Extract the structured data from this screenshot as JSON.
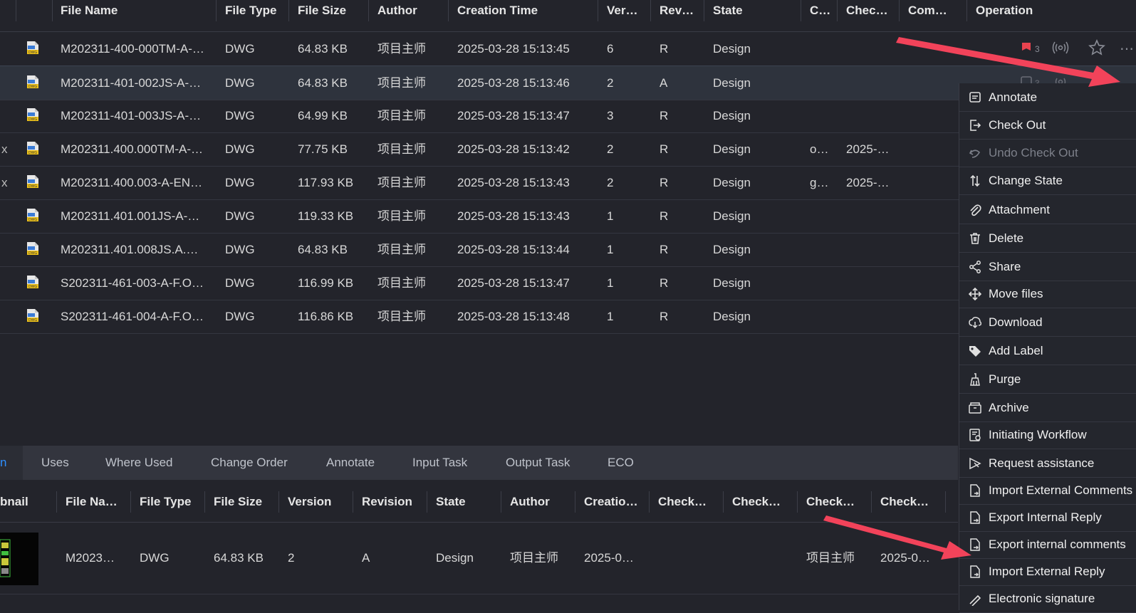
{
  "columns": {
    "file_name": "File Name",
    "file_type": "File Type",
    "file_size": "File Size",
    "author": "Author",
    "creation_time": "Creation Time",
    "version": "Ver…",
    "revision": "Rev…",
    "state": "State",
    "c": "C…",
    "check": "Chec…",
    "com": "Com…",
    "operation": "Operation"
  },
  "rows": [
    {
      "name": "M202311-400-000TM-A-…",
      "type": "DWG",
      "size": "64.83 KB",
      "author": "项目主师",
      "time": "2025-03-28 15:13:45",
      "ver": "6",
      "rev": "R",
      "state": "Design",
      "c": "",
      "check": ""
    },
    {
      "name": "M202311-401-002JS-A-…",
      "type": "DWG",
      "size": "64.83 KB",
      "author": "项目主师",
      "time": "2025-03-28 15:13:46",
      "ver": "2",
      "rev": "A",
      "state": "Design",
      "c": "",
      "check": ""
    },
    {
      "name": "M202311-401-003JS-A-…",
      "type": "DWG",
      "size": "64.99 KB",
      "author": "项目主师",
      "time": "2025-03-28 15:13:47",
      "ver": "3",
      "rev": "R",
      "state": "Design",
      "c": "",
      "check": ""
    },
    {
      "name": "M202311.400.000TM-A-…",
      "type": "DWG",
      "size": "77.75 KB",
      "author": "项目主师",
      "time": "2025-03-28 15:13:42",
      "ver": "2",
      "rev": "R",
      "state": "Design",
      "c": "o…",
      "check": "2025-…"
    },
    {
      "name": "M202311.400.003-A-EN…",
      "type": "DWG",
      "size": "117.93 KB",
      "author": "项目主师",
      "time": "2025-03-28 15:13:43",
      "ver": "2",
      "rev": "R",
      "state": "Design",
      "c": "g…",
      "check": "2025-…"
    },
    {
      "name": "M202311.401.001JS-A-…",
      "type": "DWG",
      "size": "119.33 KB",
      "author": "项目主师",
      "time": "2025-03-28 15:13:43",
      "ver": "1",
      "rev": "R",
      "state": "Design",
      "c": "",
      "check": ""
    },
    {
      "name": "M202311.401.008JS.A.…",
      "type": "DWG",
      "size": "64.83 KB",
      "author": "项目主师",
      "time": "2025-03-28 15:13:44",
      "ver": "1",
      "rev": "R",
      "state": "Design",
      "c": "",
      "check": ""
    },
    {
      "name": "S202311-461-003-A-F.O…",
      "type": "DWG",
      "size": "116.99 KB",
      "author": "项目主师",
      "time": "2025-03-28 15:13:47",
      "ver": "1",
      "rev": "R",
      "state": "Design",
      "c": "",
      "check": ""
    },
    {
      "name": "S202311-461-004-A-F.O…",
      "type": "DWG",
      "size": "116.86 KB",
      "author": "项目主师",
      "time": "2025-03-28 15:13:48",
      "ver": "1",
      "rev": "R",
      "state": "Design",
      "c": "",
      "check": ""
    }
  ],
  "row0_comment_count": "3",
  "row1_comment_count": "3",
  "tabs": [
    "n",
    "Uses",
    "Where Used",
    "Change Order",
    "Annotate",
    "Input Task",
    "Output Task",
    "ECO"
  ],
  "bottom_columns": [
    "bnail",
    "File Na…",
    "File Type",
    "File Size",
    "Version",
    "Revision",
    "State",
    "Author",
    "Creatio…",
    "Check…",
    "Check…",
    "Check…",
    "Check…"
  ],
  "bottom_row": {
    "name": "M2023…",
    "type": "DWG",
    "size": "64.83 KB",
    "version": "2",
    "revision": "A",
    "state": "Design",
    "author": "项目主师",
    "creation": "2025-0…",
    "check3": "项目主师",
    "check4": "2025-0…"
  },
  "menu": [
    {
      "label": "Annotate",
      "icon": "comment-icon",
      "disabled": false
    },
    {
      "label": "Check Out",
      "icon": "check-out-icon",
      "disabled": false
    },
    {
      "label": "Undo Check Out",
      "icon": "undo-check-out-icon",
      "disabled": true
    },
    {
      "label": "Change State",
      "icon": "change-state-icon",
      "disabled": false
    },
    {
      "label": "Attachment",
      "icon": "paperclip-icon",
      "disabled": false
    },
    {
      "label": "Delete",
      "icon": "trash-icon",
      "disabled": false
    },
    {
      "label": "Share",
      "icon": "share-icon",
      "disabled": false
    },
    {
      "label": "Move files",
      "icon": "move-icon",
      "disabled": false
    },
    {
      "label": "Download",
      "icon": "cloud-download-icon",
      "disabled": false
    },
    {
      "label": "Add Label",
      "icon": "tag-icon",
      "disabled": false
    },
    {
      "label": "Purge",
      "icon": "broom-icon",
      "disabled": false
    },
    {
      "label": "Archive",
      "icon": "archive-icon",
      "disabled": false
    },
    {
      "label": "Initiating Workflow",
      "icon": "workflow-icon",
      "disabled": false
    },
    {
      "label": "Request assistance",
      "icon": "request-assistance-icon",
      "disabled": false
    },
    {
      "label": "Import External Comments",
      "icon": "import-icon",
      "disabled": false
    },
    {
      "label": "Export Internal Reply",
      "icon": "export-icon",
      "disabled": false
    },
    {
      "label": "Export internal comments",
      "icon": "export-icon",
      "disabled": false
    },
    {
      "label": "Import External Reply",
      "icon": "import-icon",
      "disabled": false
    },
    {
      "label": "Electronic signature",
      "icon": "signature-icon",
      "disabled": false
    }
  ],
  "colors": {
    "accent": "#2e8fff",
    "flag": "#e8434f",
    "arrow": "#f2435a"
  }
}
